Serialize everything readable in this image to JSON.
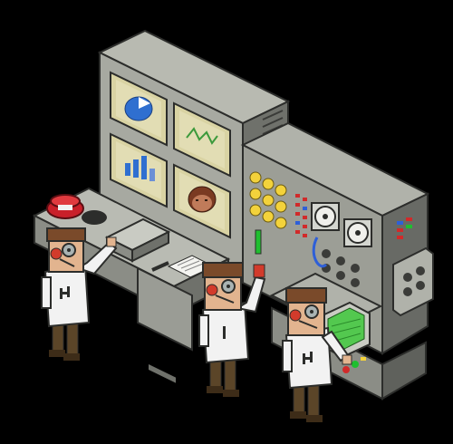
{
  "scene": {
    "background": "#000000",
    "palette": {
      "console_light": "#a7a9a1",
      "console_mid": "#8b8d86",
      "console_dark": "#5f615c",
      "outline": "#2c2d2b",
      "screen_bezel": "#d9d3a3",
      "screen_bg": "#d9d6ae",
      "pie_blue": "#2f6fd0",
      "graph_green": "#3c9a3c",
      "knob_yellow": "#f3d23b",
      "led_red": "#d12a2a",
      "led_blue": "#2e5fd8",
      "led_green": "#1fbf2f",
      "terminal_green": "#53c84f",
      "phone_red": "#c9202a",
      "skin": "#e2b48f",
      "hair": "#7a4a2a",
      "shirt": "#f2f2f2",
      "pants": "#5b4528",
      "headset_red": "#d23b2b",
      "glasses": "#7b8a8a"
    },
    "monitors": [
      {
        "content": "pie-chart-icon"
      },
      {
        "content": "line-graph-icon"
      },
      {
        "content": "bar-chart-icon"
      },
      {
        "content": "face-icon"
      }
    ],
    "scientists": [
      {
        "pose": "reaching-up"
      },
      {
        "pose": "waving"
      },
      {
        "pose": "pointing-terminal"
      }
    ]
  }
}
